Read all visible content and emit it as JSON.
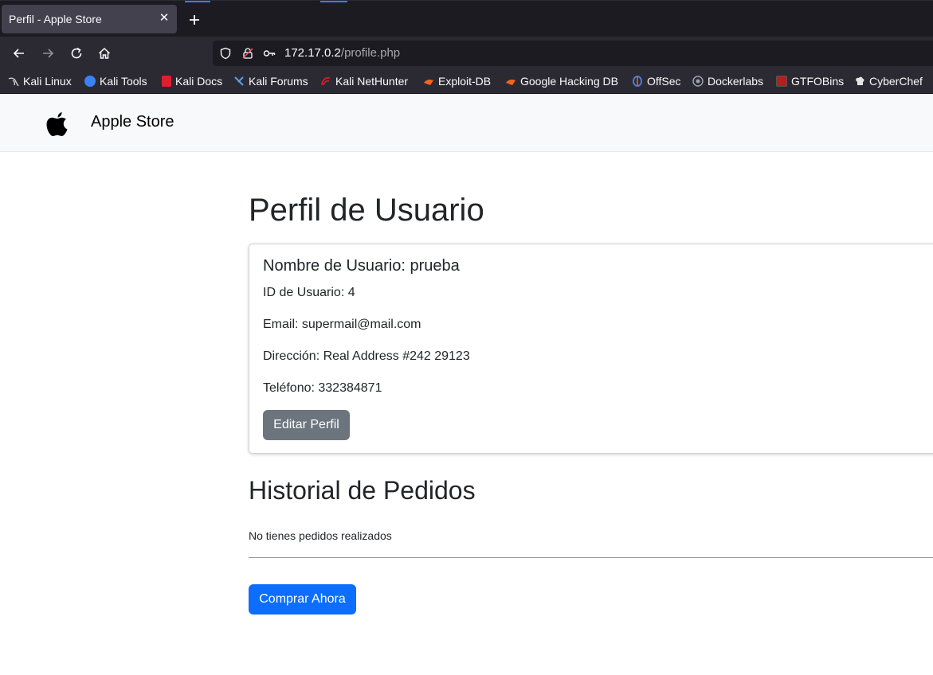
{
  "browser": {
    "tab_title": "Perfil - Apple Store",
    "url_host": "172.17.0.2",
    "url_path": "/profile.php",
    "bookmarks": [
      {
        "label": "Kali Linux",
        "icon": "kali-dragon-icon",
        "color": "#cfcfcf"
      },
      {
        "label": "Kali Tools",
        "icon": "kali-tools-icon",
        "color": "#3b82f6"
      },
      {
        "label": "Kali Docs",
        "icon": "kali-docs-icon",
        "color": "#e11d2e"
      },
      {
        "label": "Kali Forums",
        "icon": "kali-forums-icon",
        "color": "#5aa0e6"
      },
      {
        "label": "Kali NetHunter",
        "icon": "kali-nethunter-icon",
        "color": "#e11d2e"
      },
      {
        "label": "Exploit-DB",
        "icon": "exploit-db-icon",
        "color": "#f4641d"
      },
      {
        "label": "Google Hacking DB",
        "icon": "ghdb-icon",
        "color": "#f4641d"
      },
      {
        "label": "OffSec",
        "icon": "offsec-icon",
        "color": "#4a7bd8"
      },
      {
        "label": "Dockerlabs",
        "icon": "dockerlabs-icon",
        "color": "#9aa3ad"
      },
      {
        "label": "GTFOBins",
        "icon": "gtfobins-icon",
        "color": "#b91c1c"
      },
      {
        "label": "CyberChef",
        "icon": "cyberchef-icon",
        "color": "#e5e5e5"
      }
    ]
  },
  "site": {
    "brand": "Apple Store"
  },
  "profile": {
    "title": "Perfil de Usuario",
    "username_line": "Nombre de Usuario: prueba",
    "id_line": "ID de Usuario: 4",
    "email_line": "Email: supermail@mail.com",
    "address_line": "Dirección: Real Address #242 29123",
    "phone_line": "Teléfono: 332384871",
    "edit_button": "Editar Perfil"
  },
  "orders": {
    "title": "Historial de Pedidos",
    "empty_text": "No tienes pedidos realizados",
    "buy_button": "Comprar Ahora"
  }
}
